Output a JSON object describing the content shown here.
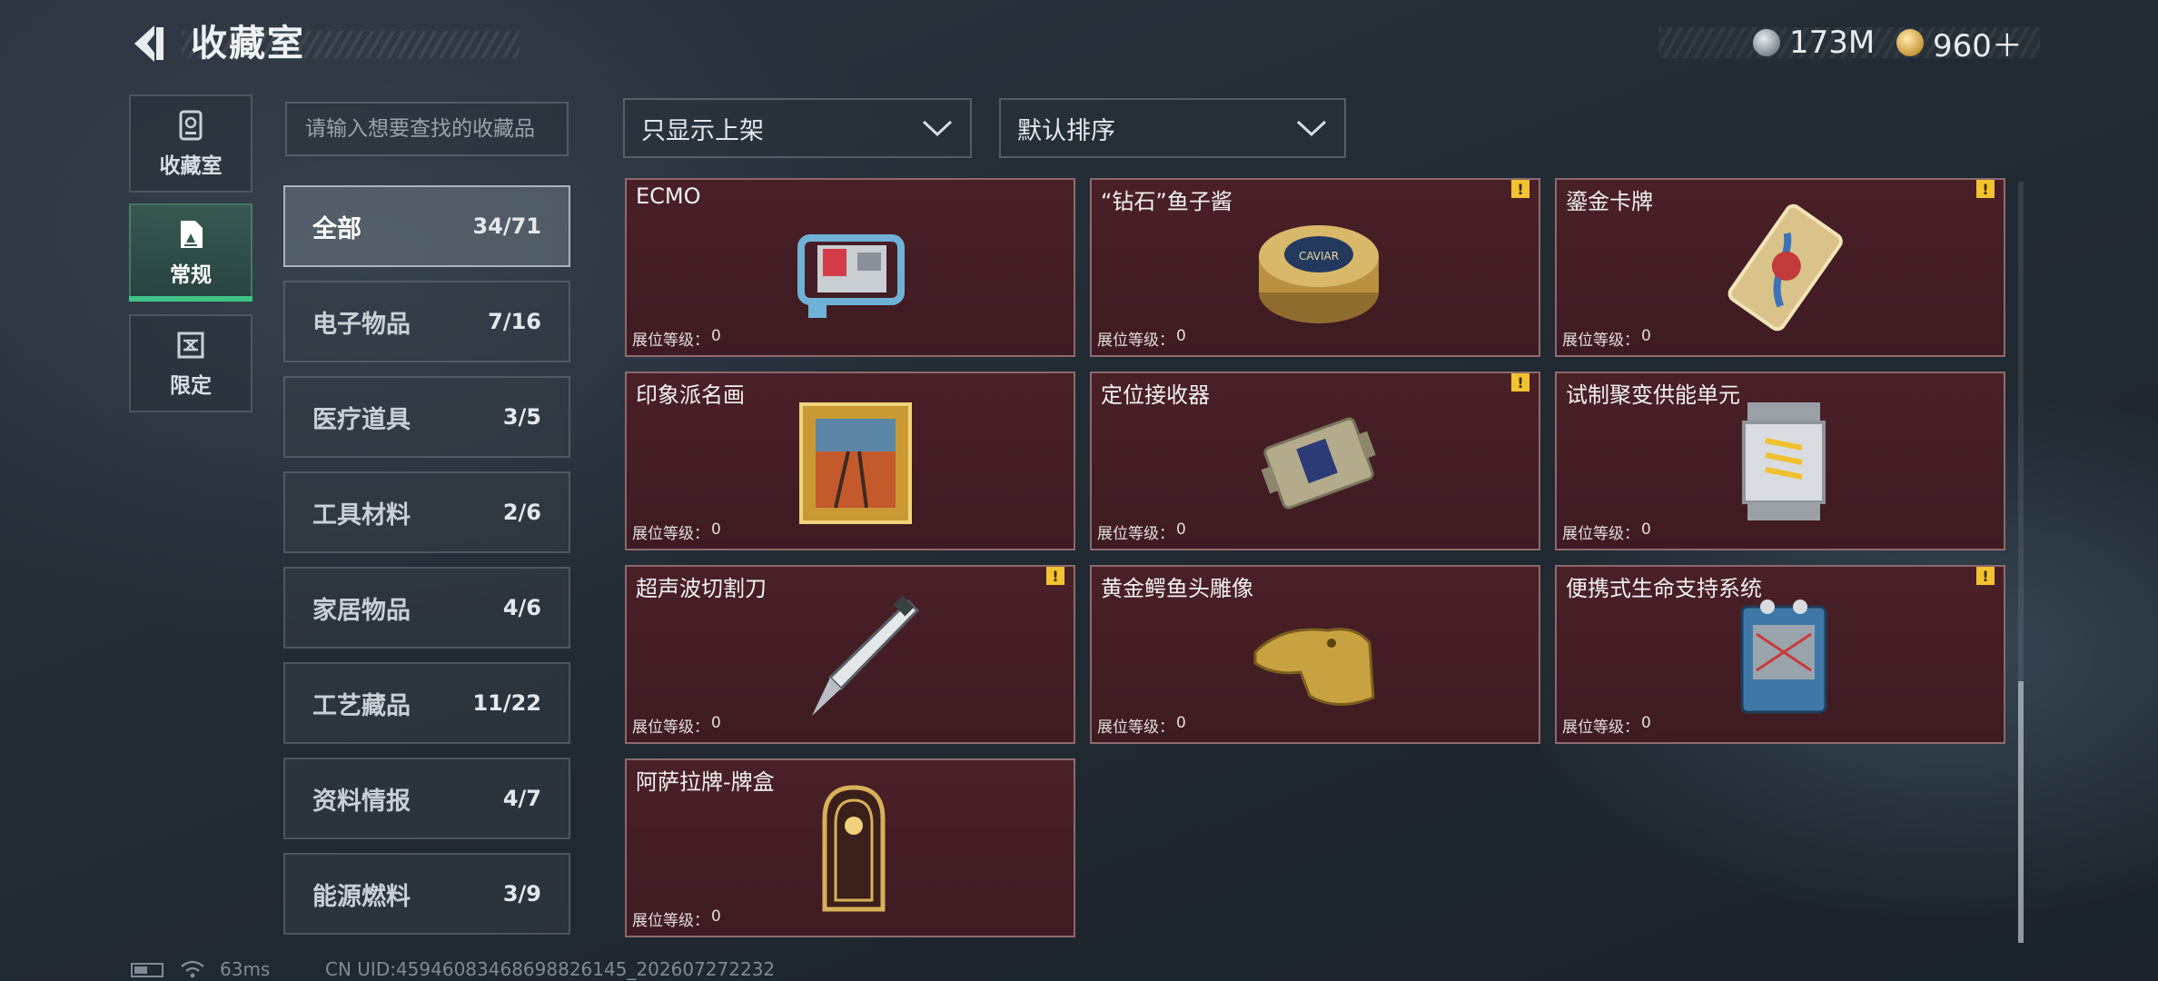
{
  "header": {
    "title": "收藏室",
    "currencies": [
      {
        "icon": "silver-coin-icon",
        "value": "173M"
      },
      {
        "icon": "gold-coin-icon",
        "value": "960＋"
      }
    ]
  },
  "side_tabs": [
    {
      "label": "收藏室",
      "icon": "collection-room-icon",
      "active": false
    },
    {
      "label": "常规",
      "icon": "regular-card-icon",
      "active": true
    },
    {
      "label": "限定",
      "icon": "limited-icon",
      "active": false
    }
  ],
  "search": {
    "placeholder": "请输入想要查找的收藏品",
    "value": ""
  },
  "categories": [
    {
      "name": "全部",
      "count": "34/71",
      "active": true
    },
    {
      "name": "电子物品",
      "count": "7/16"
    },
    {
      "name": "医疗道具",
      "count": "3/5"
    },
    {
      "name": "工具材料",
      "count": "2/6"
    },
    {
      "name": "家居物品",
      "count": "4/6"
    },
    {
      "name": "工艺藏品",
      "count": "11/22"
    },
    {
      "name": "资料情报",
      "count": "4/7"
    },
    {
      "name": "能源燃料",
      "count": "3/9"
    }
  ],
  "filters": {
    "display": "只显示上架",
    "sort": "默认排序"
  },
  "level_label": "展位等级：",
  "items": [
    {
      "name": "ECMO",
      "level": "0",
      "warning": false,
      "icon": "ecmo-machine-icon"
    },
    {
      "name": "“钻石”鱼子酱",
      "level": "0",
      "warning": true,
      "icon": "caviar-tin-icon",
      "art_text": "CAVIAR"
    },
    {
      "name": "鎏金卡牌",
      "level": "0",
      "warning": true,
      "icon": "gilded-card-icon"
    },
    {
      "name": "印象派名画",
      "level": "0",
      "warning": false,
      "icon": "framed-painting-icon"
    },
    {
      "name": "定位接收器",
      "level": "0",
      "warning": true,
      "icon": "locator-receiver-icon"
    },
    {
      "name": "试制聚变供能单元",
      "level": "0",
      "warning": false,
      "icon": "fusion-power-unit-icon"
    },
    {
      "name": "超声波切割刀",
      "level": "0",
      "warning": true,
      "icon": "ultrasonic-knife-icon"
    },
    {
      "name": "黄金鳄鱼头雕像",
      "level": "0",
      "warning": false,
      "icon": "golden-crocodile-head-icon"
    },
    {
      "name": "便携式生命支持系统",
      "level": "0",
      "warning": true,
      "icon": "life-support-system-icon"
    },
    {
      "name": "阿萨拉牌-牌盒",
      "level": "0",
      "warning": false,
      "icon": "card-box-icon"
    }
  ],
  "footer": {
    "ping": "63ms",
    "uid": "CN UID:4594608346869882614​5_202607272232"
  }
}
